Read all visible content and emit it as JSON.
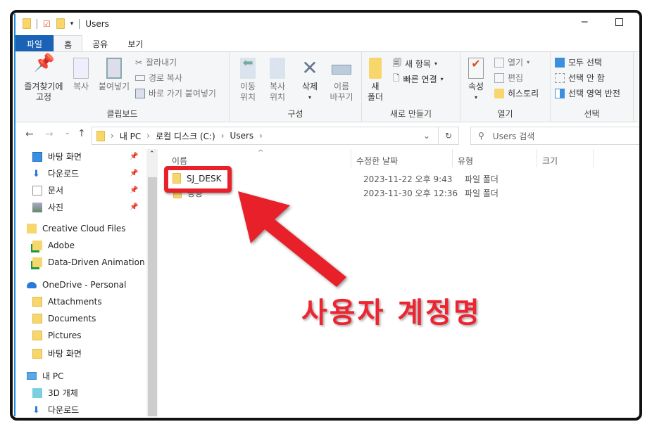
{
  "window": {
    "title": "Users"
  },
  "tabs": [
    {
      "label": "파일"
    },
    {
      "label": "홈"
    },
    {
      "label": "공유"
    },
    {
      "label": "보기"
    }
  ],
  "ribbon": {
    "clipboard": {
      "label": "클립보드",
      "pin": "즐겨찾기에",
      "pin2": "고정",
      "copy": "복사",
      "paste": "붙여넣기",
      "cut": "잘라내기",
      "copy_path": "경로 복사",
      "paste_shortcut": "바로 가기 붙여넣기"
    },
    "organize": {
      "label": "구성",
      "move1": "이동",
      "move2": "위치",
      "copyto1": "복사",
      "copyto2": "위치",
      "delete": "삭제",
      "rename1": "이름",
      "rename2": "바꾸기"
    },
    "new": {
      "label": "새로 만들기",
      "folder1": "새",
      "folder2": "폴더",
      "new_item": "새 항목",
      "easy_access": "빠른 연결"
    },
    "open": {
      "label": "열기",
      "properties": "속성",
      "open": "열기",
      "edit": "편집",
      "history": "히스토리"
    },
    "select": {
      "label": "선택",
      "all": "모두 선택",
      "none": "선택 안 함",
      "invert": "선택 영역 반전"
    }
  },
  "address": {
    "crumbs": [
      "내 PC",
      "로컬 디스크 (C:)",
      "Users"
    ]
  },
  "search": {
    "placeholder": "Users 검색"
  },
  "sidebar": {
    "items": [
      {
        "label": "바탕 화면",
        "icon": "desktop-icon",
        "pinned": true
      },
      {
        "label": "다운로드",
        "icon": "download-icon",
        "pinned": true
      },
      {
        "label": "문서",
        "icon": "document-icon",
        "pinned": true
      },
      {
        "label": "사진",
        "icon": "pictures-icon",
        "pinned": true
      },
      {
        "label": "Creative Cloud Files",
        "icon": "creative-cloud-icon"
      },
      {
        "label": "Adobe",
        "icon": "synced-folder-icon"
      },
      {
        "label": "Data-Driven Animation",
        "icon": "synced-folder-icon"
      },
      {
        "label": "OneDrive - Personal",
        "icon": "onedrive-icon"
      },
      {
        "label": "Attachments",
        "icon": "folder-icon"
      },
      {
        "label": "Documents",
        "icon": "folder-icon"
      },
      {
        "label": "Pictures",
        "icon": "folder-icon"
      },
      {
        "label": "바탕 화면",
        "icon": "folder-icon"
      },
      {
        "label": "내 PC",
        "icon": "pc-icon"
      },
      {
        "label": "3D 개체",
        "icon": "3d-objects-icon"
      },
      {
        "label": "다운로드",
        "icon": "download-icon"
      }
    ]
  },
  "columns": {
    "name": "이름",
    "date": "수정한 날짜",
    "type": "유형",
    "size": "크기"
  },
  "files": [
    {
      "name": "SJ_DESK",
      "date": "2023-11-22 오후 9:43",
      "type": "파일 폴더"
    },
    {
      "name": "공용",
      "date": "2023-11-30 오후 12:36",
      "type": "파일 폴더"
    }
  ],
  "annotation": {
    "text": "사용자 계정명",
    "color": "#ee2530"
  }
}
